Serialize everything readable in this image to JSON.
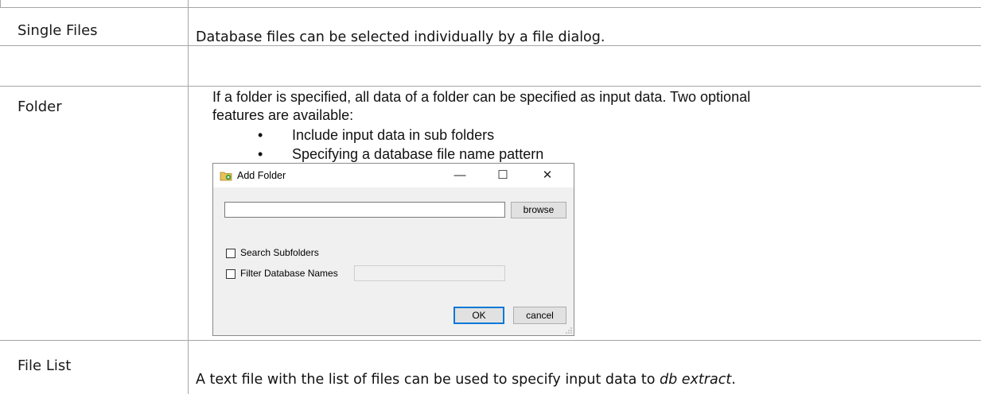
{
  "rows": [
    {
      "label": "Single Files",
      "description": "Database files can be selected individually by a file dialog."
    },
    {
      "label": "Folder",
      "description_line1": "If a folder is specified, all data of a folder can be specified as input data. Two optional",
      "description_line2": "features are available:",
      "bullets": [
        "Include input data in sub folders",
        "Specifying a database file name pattern"
      ]
    },
    {
      "label": "File List",
      "description_pre": "A text file with the list of files can be used to specify input data to ",
      "description_em": "db extract",
      "description_post": "."
    }
  ],
  "dialog": {
    "title": "Add Folder",
    "minimize_glyph": "—",
    "maximize_glyph": "☐",
    "close_glyph": "✕",
    "folder_path_value": "",
    "browse_label": "browse",
    "search_subfolders_label": "Search Subfolders",
    "search_subfolders_checked": false,
    "filter_names_label": "Filter Database Names",
    "filter_names_checked": false,
    "filter_value": "",
    "ok_label": "OK",
    "cancel_label": "cancel",
    "icon": "folder-add-icon"
  },
  "colors": {
    "grid": "#a6a6a6",
    "dialog_bg": "#f0f0f0",
    "default_button_border": "#0078d7"
  }
}
